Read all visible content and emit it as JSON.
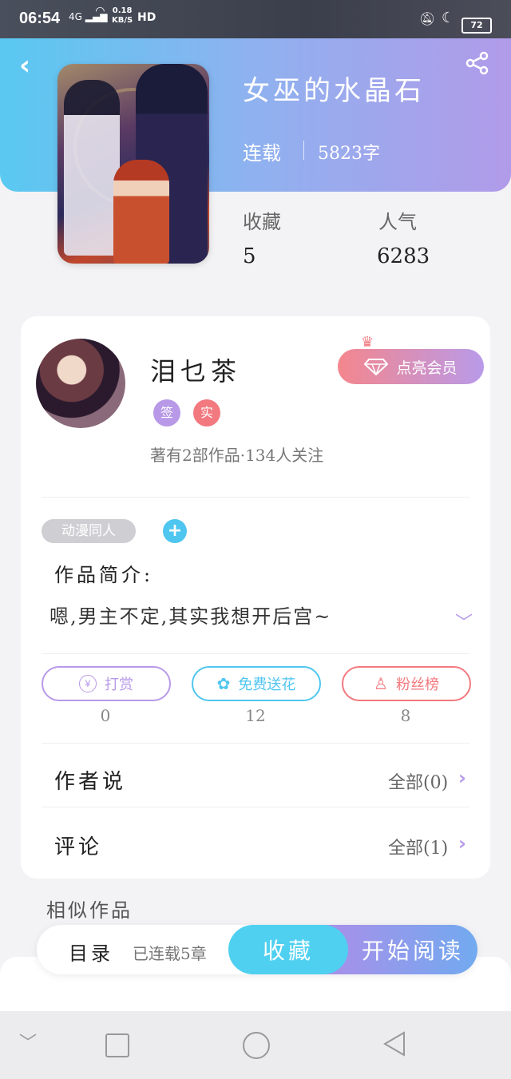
{
  "status_bar": {
    "time": "06:54",
    "signal": "4G",
    "speed_value": "0.18",
    "speed_unit": "KB/S",
    "hd": "HD",
    "battery": "72"
  },
  "book": {
    "title": "女巫的水晶石",
    "status": "连载",
    "word_count": "5823字",
    "favorites_label": "收藏",
    "favorites_value": "5",
    "popularity_label": "人气",
    "popularity_value": "6283"
  },
  "author": {
    "name": "泪乜茶",
    "badge_signed": "签",
    "badge_verified": "实",
    "meta": "著有2部作品·134人关注",
    "vip_button": "点亮会员"
  },
  "intro": {
    "tag": "动漫同人",
    "label": "作品简介:",
    "text": "嗯,男主不定,其实我想开后宫~"
  },
  "actions": [
    {
      "label": "打赏",
      "count": "0",
      "color": "#b899e8"
    },
    {
      "label": "免费送花",
      "count": "12",
      "color": "#4fc6ef"
    },
    {
      "label": "粉丝榜",
      "count": "8",
      "color": "#f2797f"
    }
  ],
  "rows": {
    "author_says_label": "作者说",
    "author_says_right": "全部(0)",
    "comments_label": "评论",
    "comments_right": "全部(1)"
  },
  "similar_label": "相似作品",
  "bottom_bar": {
    "toc": "目录",
    "chapters": "已连载5章",
    "favorite": "收藏",
    "start_reading": "开始阅读"
  },
  "icons": {
    "back": "back-arrow-icon",
    "share": "share-icon",
    "diamond": "diamond-icon",
    "crown": "crown-icon"
  }
}
